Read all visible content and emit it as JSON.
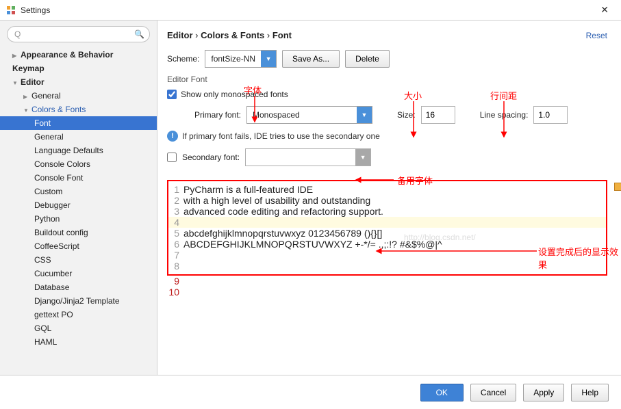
{
  "window": {
    "title": "Settings"
  },
  "sidebar": {
    "search_placeholder": "",
    "items": [
      {
        "label": "Appearance & Behavior",
        "bold": true,
        "level": 1,
        "arrow": "right"
      },
      {
        "label": "Keymap",
        "bold": true,
        "level": 1
      },
      {
        "label": "Editor",
        "bold": true,
        "level": 1,
        "arrow": "down"
      },
      {
        "label": "General",
        "level": 2,
        "arrow": "right"
      },
      {
        "label": "Colors & Fonts",
        "level": 2,
        "arrow": "down",
        "blue": true
      },
      {
        "label": "Font",
        "level": 3,
        "selected": true
      },
      {
        "label": "General",
        "level": 3
      },
      {
        "label": "Language Defaults",
        "level": 3
      },
      {
        "label": "Console Colors",
        "level": 3
      },
      {
        "label": "Console Font",
        "level": 3
      },
      {
        "label": "Custom",
        "level": 3
      },
      {
        "label": "Debugger",
        "level": 3
      },
      {
        "label": "Python",
        "level": 3
      },
      {
        "label": "Buildout config",
        "level": 3
      },
      {
        "label": "CoffeeScript",
        "level": 3
      },
      {
        "label": "CSS",
        "level": 3
      },
      {
        "label": "Cucumber",
        "level": 3
      },
      {
        "label": "Database",
        "level": 3
      },
      {
        "label": "Django/Jinja2 Template",
        "level": 3
      },
      {
        "label": "gettext PO",
        "level": 3
      },
      {
        "label": "GQL",
        "level": 3
      },
      {
        "label": "HAML",
        "level": 3
      }
    ]
  },
  "breadcrumb": {
    "p1": "Editor",
    "p2": "Colors & Fonts",
    "p3": "Font"
  },
  "reset": "Reset",
  "form": {
    "scheme_label": "Scheme:",
    "scheme_value": "fontSize-NN",
    "save_as": "Save As...",
    "delete": "Delete",
    "editor_font_head": "Editor Font",
    "show_mono": "Show only monospaced fonts",
    "primary_label": "Primary font:",
    "primary_value": "Monospaced",
    "size_label": "Size:",
    "size_value": "16",
    "spacing_label": "Line spacing:",
    "spacing_value": "1.0",
    "info_text": "If primary font fails, IDE tries to use the secondary one",
    "secondary_label": "Secondary font:",
    "secondary_value": ""
  },
  "annotations": {
    "font_label": "字体",
    "size_label": "大小",
    "spacing_label": "行间距",
    "secondary_label": "备用字体",
    "preview_label": "设置完成后的显示效果"
  },
  "preview": {
    "lines": [
      "PyCharm is a full-featured IDE",
      "with a high level of usability and outstanding",
      "advanced code editing and refactoring support.",
      "",
      "abcdefghijklmnopqrstuvwxyz 0123456789 (){}[]",
      "ABCDEFGHIJKLMNOPQRSTUVWXYZ +-*/= .,;:!? #&$%@|^",
      "",
      ""
    ],
    "extra": [
      9,
      10
    ]
  },
  "buttons": {
    "ok": "OK",
    "cancel": "Cancel",
    "apply": "Apply",
    "help": "Help"
  },
  "watermark": "http://blog.csdn.net/"
}
